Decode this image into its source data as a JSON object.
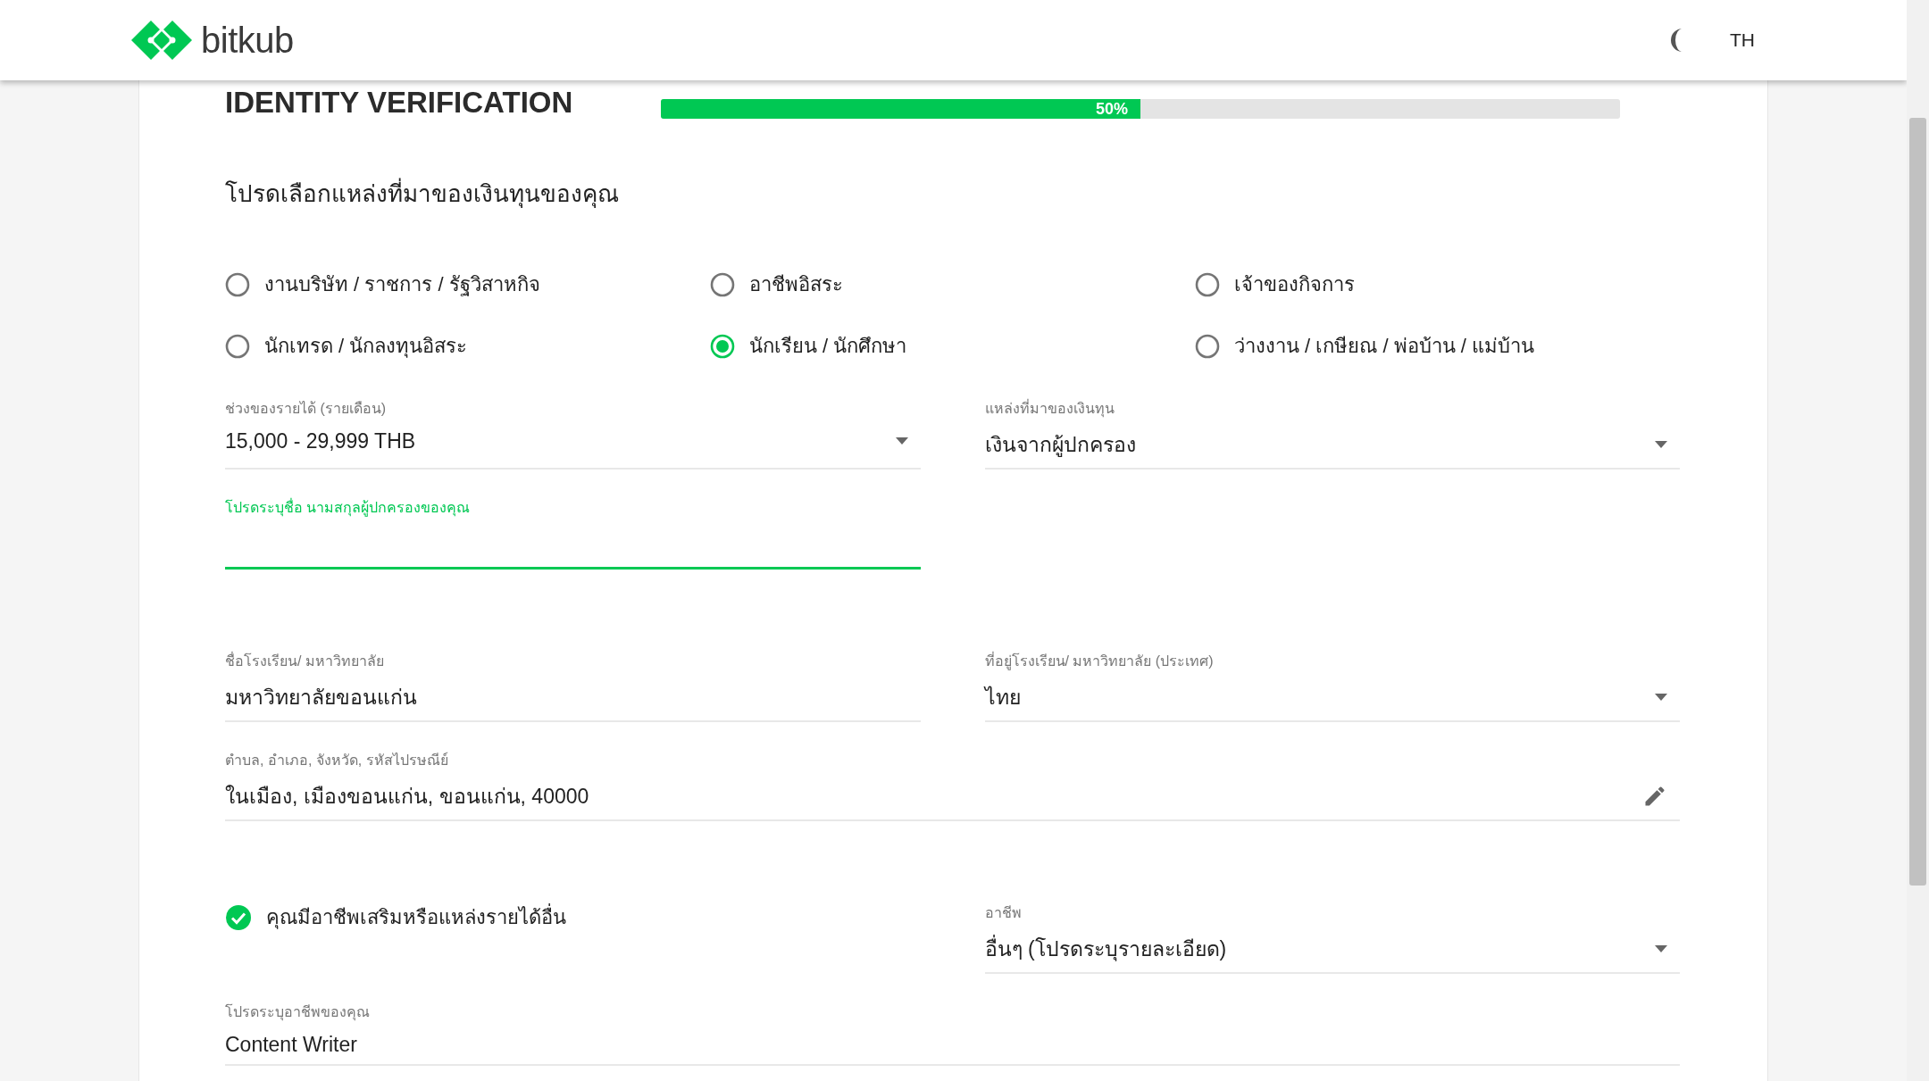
{
  "header": {
    "logo_text": "bitkub",
    "language": "TH"
  },
  "title": "IDENTITY VERIFICATION",
  "progress": {
    "level": 0.5,
    "label": "50%"
  },
  "question": "โปรดเลือกแหล่งที่มาของเงินทุนของคุณ",
  "radio_options": [
    {
      "label": "งานบริษัท / ราชการ / รัฐวิสาหกิจ",
      "selected": false
    },
    {
      "label": "อาชีพอิสระ",
      "selected": false
    },
    {
      "label": "เจ้าของกิจการ",
      "selected": false
    },
    {
      "label": "นักเทรด / นักลงทุนอิสระ",
      "selected": false
    },
    {
      "label": "นักเรียน / นักศึกษา",
      "selected": true
    },
    {
      "label": "ว่างงาน / เกษียณ / พ่อบ้าน / แม่บ้าน",
      "selected": false
    }
  ],
  "rows": [
    {
      "fields": [
        {
          "kind": "select",
          "label": "ช่วงของรายได้ (รายเดือน)",
          "value": "15,000 - 29,999 THB",
          "focused": false,
          "wide": false
        },
        {
          "kind": "select",
          "label": "แหล่งที่มาของเงินทุน",
          "value": "เงินจากผู้ปกครอง",
          "focused": false,
          "wide": false
        }
      ]
    },
    {
      "fields": [
        {
          "kind": "input",
          "label": "โปรดระบุชื่อ นามสกุลผู้ปกครองของคุณ",
          "focused": true,
          "wide": false
        }
      ]
    },
    {
      "fields": [
        {
          "kind": "input",
          "label": "ชื่อโรงเรียน/ มหาวิทยาลัย",
          "value": "มหาวิทยาลัยขอนแก่น",
          "focused": false,
          "wide": false
        },
        {
          "kind": "select",
          "label": "ที่อยู่โรงเรียน/ มหาวิทยาลัย (ประเทศ)",
          "value": "ไทย",
          "focused": false,
          "wide": false
        }
      ]
    },
    {
      "fields": [
        {
          "kind": "editable",
          "label": "ตำบล, อำเภอ, จังหวัด, รหัสไปรษณีย์",
          "value": "ในเมือง, เมืองขอนแก่น, ขอนแก่น, 40000",
          "focused": false,
          "wide": true
        }
      ]
    },
    {
      "fields": [
        {
          "kind": "checkbox",
          "label": "คุณมีอาชีพเสริมหรือแหล่งรายได้อื่น",
          "checked": true,
          "wide": false
        },
        {
          "kind": "select",
          "label": "อาชีพ",
          "value": "อื่นๆ (โปรดระบุรายละเอียด)",
          "focused": false,
          "wide": false
        }
      ]
    },
    {
      "fields": [
        {
          "kind": "input",
          "label": "โปรดระบุอาชีพของคุณ",
          "value": "Content Writer",
          "focused": false,
          "wide": true
        }
      ]
    }
  ]
}
